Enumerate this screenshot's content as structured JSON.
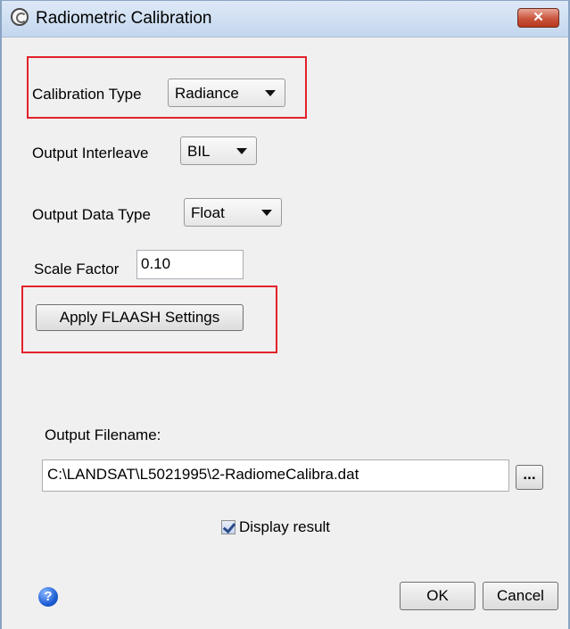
{
  "window": {
    "title": "Radiometric Calibration",
    "close_glyph": "✕"
  },
  "form": {
    "calibration_type": {
      "label": "Calibration Type",
      "value": "Radiance"
    },
    "output_interleave": {
      "label": "Output Interleave",
      "value": "BIL"
    },
    "output_data_type": {
      "label": "Output Data Type",
      "value": "Float"
    },
    "scale_factor": {
      "label": "Scale Factor",
      "value": "0.10"
    },
    "apply_flaash_label": "Apply FLAASH Settings",
    "output_filename": {
      "label": "Output Filename:",
      "value": "C:\\LANDSAT\\L5021995\\2-RadiomeCalibra.dat",
      "browse_label": "..."
    },
    "display_result": {
      "label": "Display result",
      "checked": true
    }
  },
  "footer": {
    "help_glyph": "?",
    "ok_label": "OK",
    "cancel_label": "Cancel"
  },
  "colors": {
    "highlight": "#e3212b",
    "titlebar": "#c4d7ee",
    "close_button": "#c9543c"
  }
}
